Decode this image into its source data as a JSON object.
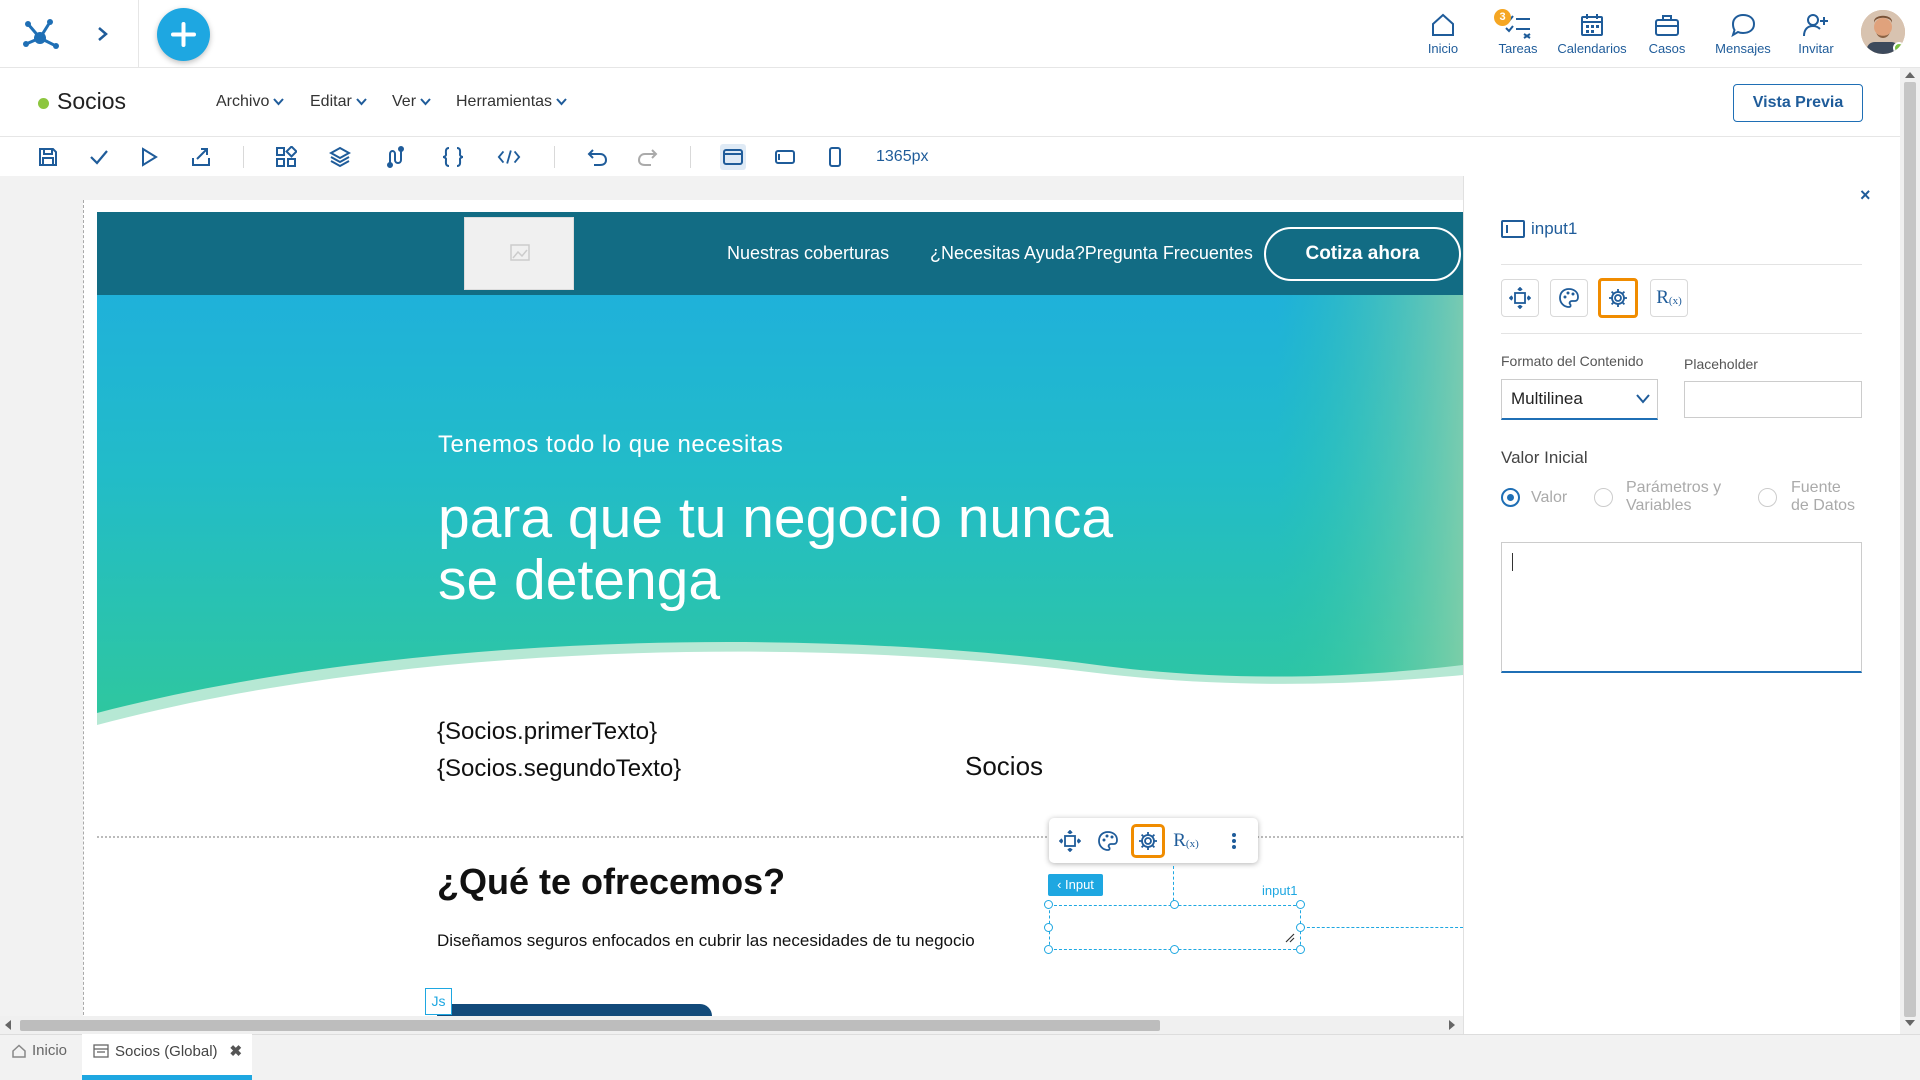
{
  "topnav": {
    "items": [
      {
        "label": "Inicio",
        "icon": "home-icon"
      },
      {
        "label": "Tareas",
        "icon": "tasks-icon",
        "badge": "3"
      },
      {
        "label": "Calendarios",
        "icon": "calendar-icon"
      },
      {
        "label": "Casos",
        "icon": "briefcase-icon"
      },
      {
        "label": "Mensajes",
        "icon": "chat-icon"
      },
      {
        "label": "Invitar",
        "icon": "add-user-icon"
      }
    ]
  },
  "title": {
    "name": "Socios",
    "status_color": "#8dc63f"
  },
  "menu": [
    "Archivo",
    "Editar",
    "Ver",
    "Herramientas"
  ],
  "preview_label": "Vista Previa",
  "toolbar": {
    "zoom": "1365px"
  },
  "site": {
    "links": [
      "Nuestras coberturas",
      "¿Necesitas Ayuda?Pregunta Frecuentes"
    ],
    "cta": "Cotiza ahora",
    "hero_tagline": "Tenemos todo lo que necesitas",
    "hero_title": "para que tu negocio nunca se detenga",
    "template1": "{Socios.primerTexto}",
    "template2": "{Socios.segundoTexto}",
    "socios_label": "Socios",
    "section_title": "¿Qué te ofrecemos?",
    "section_desc": "Diseñamos seguros enfocados en cubrir las necesidades de tu negocio",
    "js_badge": "Js"
  },
  "selection": {
    "tag": "‹ Input",
    "name": "input1"
  },
  "panel": {
    "close": "×",
    "component_name": "input1",
    "format_label": "Formato del Contenido",
    "format_value": "Multilinea",
    "placeholder_label": "Placeholder",
    "placeholder_value": "",
    "initial_label": "Valor Inicial",
    "radio_valor": "Valor",
    "radio_params_1": "Parámetros y",
    "radio_params_2": "Variables",
    "radio_fuente_1": "Fuente",
    "radio_fuente_2": "de Datos",
    "initial_value": ""
  },
  "bottom_tabs": [
    {
      "label": "Inicio"
    },
    {
      "label": "Socios (Global)"
    }
  ],
  "colors": {
    "accent": "#1ea7e1",
    "brand": "#1f5c9a",
    "header": "#126c84",
    "selected": "#f08c00"
  }
}
